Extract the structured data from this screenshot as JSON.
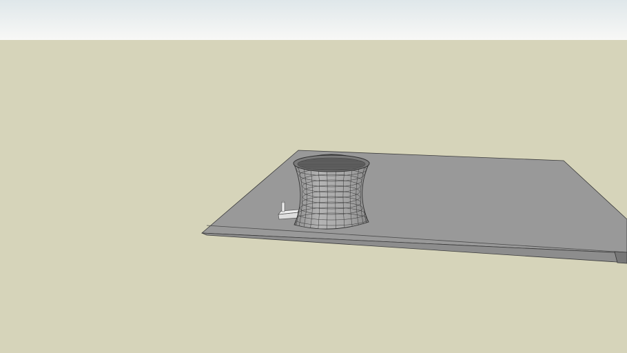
{
  "viewport": {
    "sky_top_color": "#dfe7ea",
    "sky_bottom_color": "#f7f8f7",
    "ground_color": "#d6d4ba",
    "edge_color": "#3a3a3a"
  },
  "model": {
    "platform_color": "#999999",
    "platform_front_color": "#8c8c8c",
    "tower_color": "#a7a7a7",
    "tower_inner_color": "#6f6f6f",
    "annex_color": "#dcdcdc"
  }
}
